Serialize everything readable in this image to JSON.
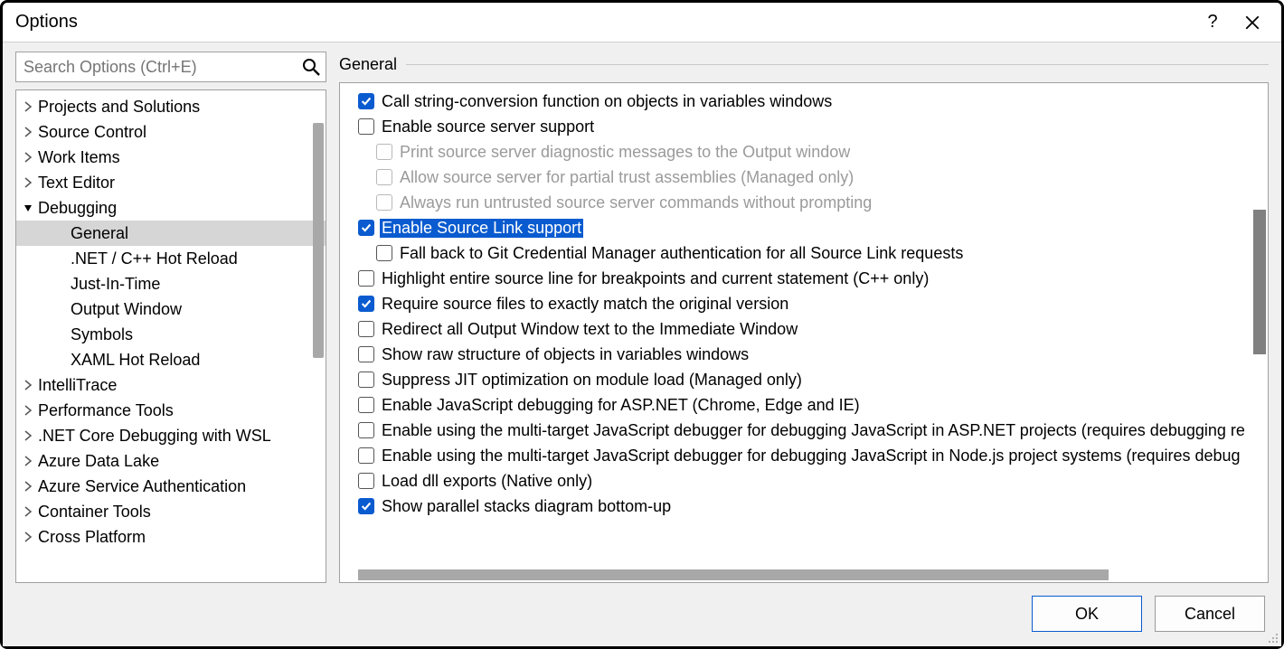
{
  "dialog": {
    "title": "Options",
    "help_tooltip": "?",
    "ok_label": "OK",
    "cancel_label": "Cancel"
  },
  "search": {
    "placeholder": "Search Options (Ctrl+E)",
    "value": ""
  },
  "tree": {
    "items": [
      {
        "label": "Projects and Solutions",
        "expanded": false,
        "level": 0
      },
      {
        "label": "Source Control",
        "expanded": false,
        "level": 0
      },
      {
        "label": "Work Items",
        "expanded": false,
        "level": 0
      },
      {
        "label": "Text Editor",
        "expanded": false,
        "level": 0
      },
      {
        "label": "Debugging",
        "expanded": true,
        "level": 0
      },
      {
        "label": "General",
        "expanded": null,
        "level": 1,
        "selected": true
      },
      {
        "label": ".NET / C++ Hot Reload",
        "expanded": null,
        "level": 1
      },
      {
        "label": "Just-In-Time",
        "expanded": null,
        "level": 1
      },
      {
        "label": "Output Window",
        "expanded": null,
        "level": 1
      },
      {
        "label": "Symbols",
        "expanded": null,
        "level": 1
      },
      {
        "label": "XAML Hot Reload",
        "expanded": null,
        "level": 1
      },
      {
        "label": "IntelliTrace",
        "expanded": false,
        "level": 0
      },
      {
        "label": "Performance Tools",
        "expanded": false,
        "level": 0
      },
      {
        "label": ".NET Core Debugging with WSL",
        "expanded": false,
        "level": 0
      },
      {
        "label": "Azure Data Lake",
        "expanded": false,
        "level": 0
      },
      {
        "label": "Azure Service Authentication",
        "expanded": false,
        "level": 0
      },
      {
        "label": "Container Tools",
        "expanded": false,
        "level": 0
      },
      {
        "label": "Cross Platform",
        "expanded": false,
        "level": 0
      }
    ]
  },
  "section_header": "General",
  "options": [
    {
      "label": "Call string-conversion function on objects in variables windows",
      "checked": true,
      "indent": 1,
      "disabled": false
    },
    {
      "label": "Enable source server support",
      "checked": false,
      "indent": 1,
      "disabled": false
    },
    {
      "label": "Print source server diagnostic messages to the Output window",
      "checked": false,
      "indent": 2,
      "disabled": true
    },
    {
      "label": "Allow source server for partial trust assemblies (Managed only)",
      "checked": false,
      "indent": 2,
      "disabled": true
    },
    {
      "label": "Always run untrusted source server commands without prompting",
      "checked": false,
      "indent": 2,
      "disabled": true
    },
    {
      "label": "Enable Source Link support",
      "checked": true,
      "indent": 1,
      "disabled": false,
      "highlighted": true
    },
    {
      "label": "Fall back to Git Credential Manager authentication for all Source Link requests",
      "checked": false,
      "indent": 2,
      "disabled": false
    },
    {
      "label": "Highlight entire source line for breakpoints and current statement (C++ only)",
      "checked": false,
      "indent": 1,
      "disabled": false
    },
    {
      "label": "Require source files to exactly match the original version",
      "checked": true,
      "indent": 1,
      "disabled": false
    },
    {
      "label": "Redirect all Output Window text to the Immediate Window",
      "checked": false,
      "indent": 1,
      "disabled": false
    },
    {
      "label": "Show raw structure of objects in variables windows",
      "checked": false,
      "indent": 1,
      "disabled": false
    },
    {
      "label": "Suppress JIT optimization on module load (Managed only)",
      "checked": false,
      "indent": 1,
      "disabled": false
    },
    {
      "label": "Enable JavaScript debugging for ASP.NET (Chrome, Edge and IE)",
      "checked": false,
      "indent": 1,
      "disabled": false
    },
    {
      "label": "Enable using the multi-target JavaScript debugger for debugging JavaScript in ASP.NET projects (requires debugging re",
      "checked": false,
      "indent": 1,
      "disabled": false
    },
    {
      "label": "Enable using the multi-target JavaScript debugger for debugging JavaScript in Node.js project systems (requires debug",
      "checked": false,
      "indent": 1,
      "disabled": false
    },
    {
      "label": "Load dll exports (Native only)",
      "checked": false,
      "indent": 1,
      "disabled": false
    },
    {
      "label": "Show parallel stacks diagram bottom-up",
      "checked": true,
      "indent": 1,
      "disabled": false
    }
  ]
}
